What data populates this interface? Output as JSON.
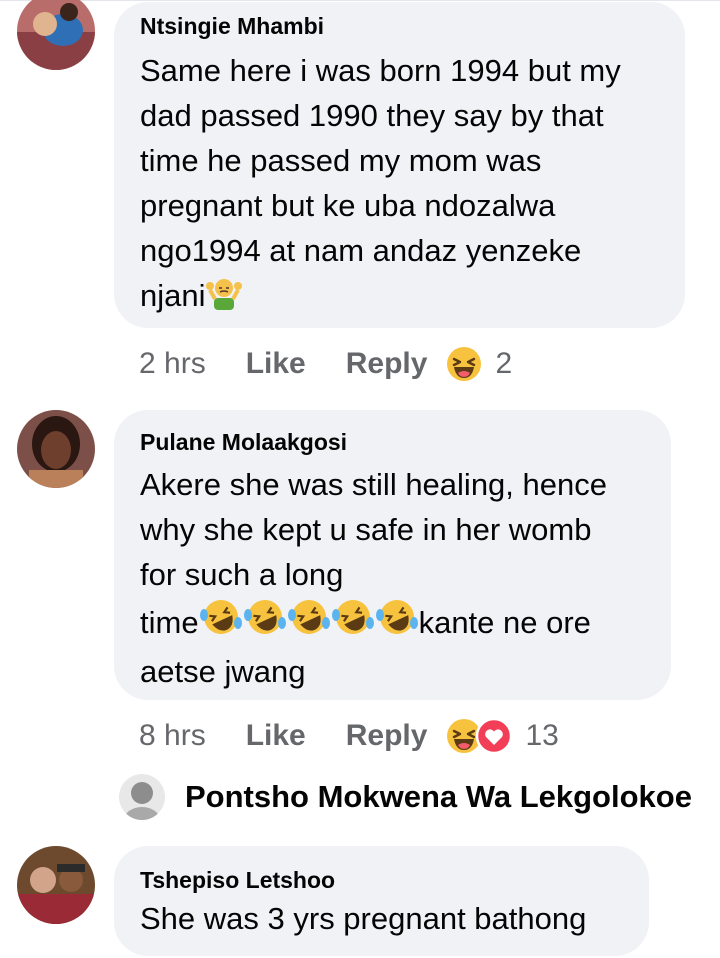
{
  "comments": [
    {
      "author": "Ntsingie Mhambi",
      "text_lines": [
        "Same here i was born 1994 but my",
        "dad passed 1990 they say by that",
        "time he passed my mom was",
        "pregnant but ke uba ndozalwa",
        "ngo1994 at nam andaz yenzeke",
        "njani"
      ],
      "emoji": "person-shrugging-emoji",
      "time": "2 hrs",
      "like_label": "Like",
      "reply_label": "Reply",
      "reaction_count": "2",
      "reactions": [
        "laughing-face-icon"
      ]
    },
    {
      "author": "Pulane Molaakgosi",
      "text_lines": [
        "Akere she was still healing, hence",
        "why she kept u safe in her womb",
        "for such a long",
        "time",
        "kante ne ore",
        "aetse jwang"
      ],
      "emoji": "rolling-on-floor-laughing-emoji",
      "time": "8 hrs",
      "like_label": "Like",
      "reply_label": "Reply",
      "reaction_count": "13",
      "reactions": [
        "laughing-face-icon",
        "heart-icon"
      ]
    },
    {
      "author": "Tshepiso Letshoo",
      "text": "She was 3 yrs pregnant bathong"
    }
  ],
  "reply_thread": {
    "author": "Pontsho Mokwena Wa Lekgolokoe"
  },
  "colors": {
    "bubble": "#f0f2f5",
    "meta_text": "#65676b",
    "name_text": "#050505",
    "laugh_yellow": "#f7c33f",
    "heart_red": "#f33e58"
  }
}
